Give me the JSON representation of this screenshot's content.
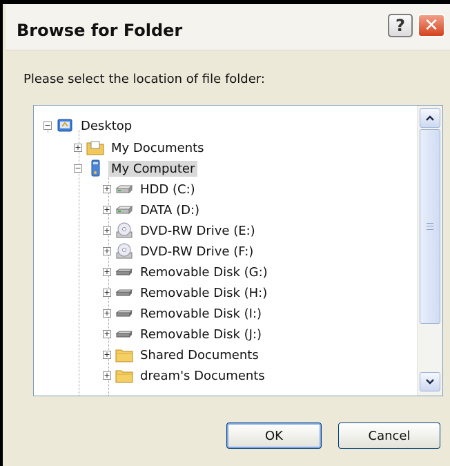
{
  "dialog": {
    "title": "Browse for Folder",
    "help_label": "?",
    "close_label": "✕",
    "prompt": "Please select the location of file folder:",
    "ok_label": "OK",
    "cancel_label": "Cancel"
  },
  "tree": {
    "root": {
      "label": "Desktop",
      "expander": "−",
      "icon": "desktop-icon"
    },
    "level1": [
      {
        "label": "My Documents",
        "expander": "+",
        "icon": "my-documents-folder-icon"
      },
      {
        "label": "My Computer",
        "expander": "−",
        "icon": "my-computer-icon",
        "selected": true
      }
    ],
    "drives": [
      {
        "label": "HDD (C:)",
        "expander": "+",
        "icon": "hard-drive-icon"
      },
      {
        "label": "DATA (D:)",
        "expander": "+",
        "icon": "hard-drive-icon"
      },
      {
        "label": "DVD-RW Drive (E:)",
        "expander": "+",
        "icon": "dvd-drive-icon"
      },
      {
        "label": "DVD-RW Drive (F:)",
        "expander": "+",
        "icon": "dvd-drive-icon"
      },
      {
        "label": "Removable Disk (G:)",
        "expander": "+",
        "icon": "removable-disk-icon"
      },
      {
        "label": "Removable Disk (H:)",
        "expander": "+",
        "icon": "removable-disk-icon"
      },
      {
        "label": "Removable Disk (I:)",
        "expander": "+",
        "icon": "removable-disk-icon"
      },
      {
        "label": "Removable Disk (J:)",
        "expander": "+",
        "icon": "removable-disk-icon"
      },
      {
        "label": "Shared Documents",
        "expander": "+",
        "icon": "folder-icon"
      },
      {
        "label": "dream's Documents",
        "expander": "+",
        "icon": "folder-icon"
      }
    ]
  },
  "colors": {
    "dialog_bg": "#ece9d8",
    "selection_bg": "#d9d9d9",
    "close_red": "#d4421f"
  }
}
